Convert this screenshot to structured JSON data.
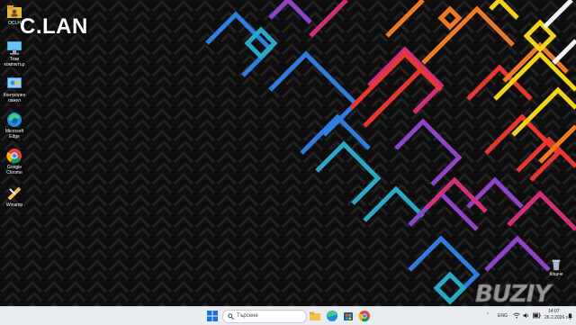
{
  "desktop": {
    "brand": "C.LAN",
    "watermark": "BUZIY",
    "icons": [
      {
        "label": "OCLH",
        "icon": "user-folder-icon"
      },
      {
        "label": "Този компютър",
        "icon": "this-pc-icon"
      },
      {
        "label": "Контролен панел",
        "icon": "control-panel-icon"
      },
      {
        "label": "Microsoft Edge",
        "icon": "edge-icon"
      },
      {
        "label": "Google Chrome",
        "icon": "chrome-icon"
      },
      {
        "label": "Winamp",
        "icon": "winamp-icon"
      }
    ],
    "recycle_bin": {
      "label": "Кошче",
      "icon": "recycle-bin-icon"
    }
  },
  "taskbar": {
    "search_placeholder": "Търсене",
    "pinned": [
      "start-icon",
      "search-icon",
      "file-explorer-icon",
      "edge-icon",
      "store-icon",
      "chrome-icon"
    ],
    "tray": {
      "language": "ENG",
      "time": "14:07",
      "date": "26.2.2026 г."
    }
  },
  "colors": {
    "wallpaper_bg": "#0d0d0d",
    "taskbar_bg": "#e9ecf1"
  }
}
